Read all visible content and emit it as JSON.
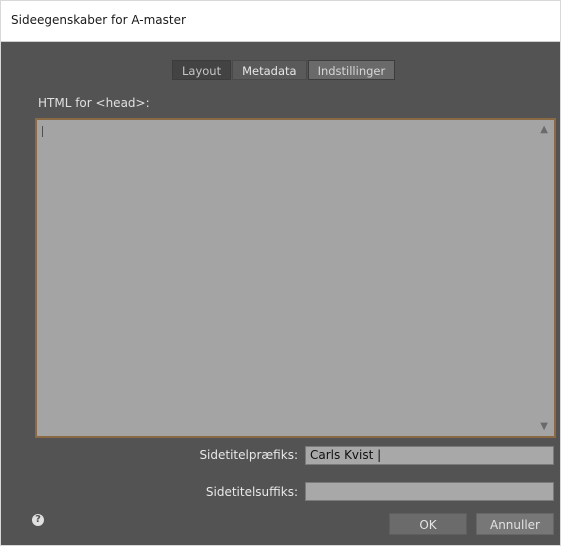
{
  "window": {
    "title": "Sideegenskaber for A-master"
  },
  "tabs": [
    {
      "label": "Layout"
    },
    {
      "label": "Metadata"
    },
    {
      "label": "Indstillinger"
    }
  ],
  "head_section": {
    "label": "HTML for <head>:",
    "value": ""
  },
  "fields": {
    "prefix": {
      "label": "Sidetitelpræfiks:",
      "value": "Carls Kvist |"
    },
    "suffix": {
      "label": "Sidetitelsuffiks:",
      "value": ""
    }
  },
  "buttons": {
    "ok": "OK",
    "cancel": "Annuller"
  },
  "icons": {
    "help": "help-icon",
    "scroll_up": "chevron-up-icon",
    "scroll_down": "chevron-down-icon"
  }
}
